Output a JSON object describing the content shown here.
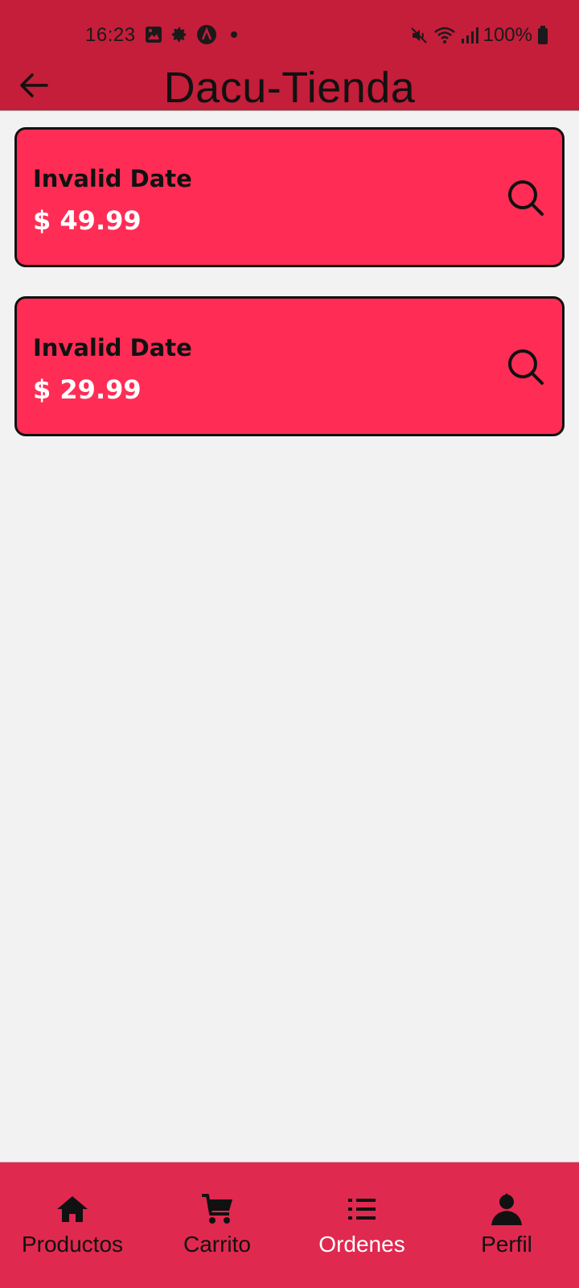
{
  "status_bar": {
    "time": "16:23",
    "battery": "100%",
    "left_icons": [
      "image-icon",
      "gear-icon",
      "app-logo-icon",
      "dot-icon"
    ],
    "right_icons": [
      "mute-icon",
      "wifi-icon",
      "signal-icon",
      "battery-icon"
    ]
  },
  "app_bar": {
    "title": "Dacu-Tienda",
    "back_icon": "arrow-left-icon"
  },
  "orders": [
    {
      "date": "Invalid Date",
      "price": "$ 49.99",
      "action_icon": "search-icon"
    },
    {
      "date": "Invalid Date",
      "price": "$ 29.99",
      "action_icon": "search-icon"
    }
  ],
  "bottom_nav": {
    "active": "Ordenes",
    "items": [
      {
        "label": "Productos",
        "icon": "home-icon"
      },
      {
        "label": "Carrito",
        "icon": "cart-icon"
      },
      {
        "label": "Ordenes",
        "icon": "list-icon"
      },
      {
        "label": "Perfil",
        "icon": "person-icon"
      }
    ]
  },
  "colors": {
    "header": "#c41e3a",
    "card": "#ff2d55",
    "bottom_nav": "#e0294f",
    "background": "#f2f2f2"
  }
}
